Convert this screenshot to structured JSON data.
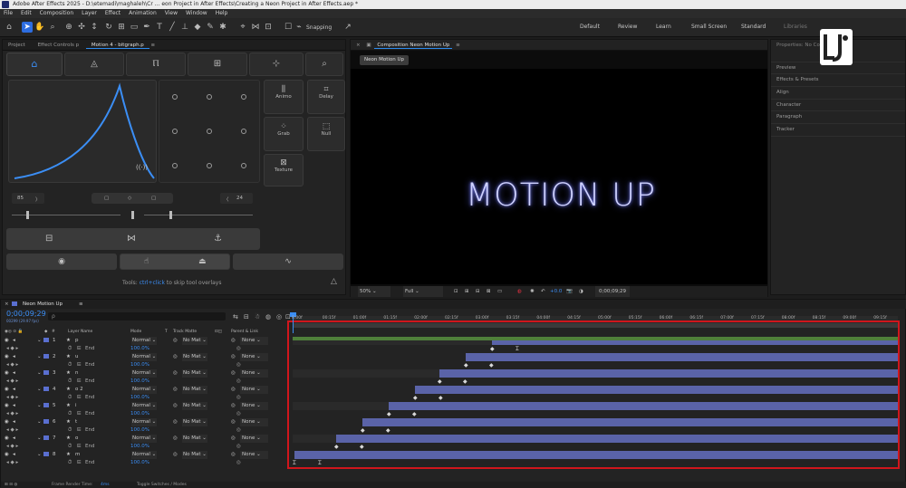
{
  "title": "Adobe After Effects 2025 - D:\\etemadi\\maghaleh\\Cr ... eon Project in After Effects\\Creating a Neon Project in After Effects.aep *",
  "menu": [
    "File",
    "Edit",
    "Composition",
    "Layer",
    "Effect",
    "Animation",
    "View",
    "Window",
    "Help"
  ],
  "toolbar": {
    "snapping": "Snapping"
  },
  "workspaces": [
    "Default",
    "Review",
    "Learn",
    "Small Screen",
    "Standard",
    "Libraries"
  ],
  "left_tabs": [
    "Project",
    "Effect Controls p",
    "Motion 4 - bitgraph.p"
  ],
  "motion": {
    "buttons": [
      "Animo",
      "Delay",
      "Grab",
      "Null",
      "Texture"
    ],
    "left_value": "85",
    "right_value": "24",
    "tools_hint_pre": "Tools:",
    "tools_hint_key": "ctrl+click",
    "tools_hint_post": "to skip tool overlays"
  },
  "comp": {
    "panel_title": "Composition Neon Motion Up",
    "tab": "Neon Motion Up",
    "text": "MOTION UP",
    "zoom": "50%",
    "resolution": "Full",
    "exposure": "+0.0",
    "timecode": "0;00;09;29"
  },
  "right_panel": {
    "items": [
      "Properties: No Co",
      "Preview",
      "Effects & Presets",
      "Align",
      "Character",
      "Paragraph",
      "Tracker"
    ],
    "logo_letters": "LJ"
  },
  "timeline": {
    "tab": "Neon Motion Up",
    "timecode": "0;00;09;29",
    "fps": "00299 (29.97 fps)",
    "search_placeholder": "ρ",
    "headers": {
      "layer_name": "Layer Name",
      "mode": "Mode",
      "t": "T",
      "track_matte": "Track Matte",
      "parent": "Parent & Link"
    },
    "ticks": [
      "0;00f",
      "00:15f",
      "01:00f",
      "01:15f",
      "02:00f",
      "02:15f",
      "03:00f",
      "03:15f",
      "04:00f",
      "04:15f",
      "05:00f",
      "05:15f",
      "06:00f",
      "06:15f",
      "07:00f",
      "07:15f",
      "08:00f",
      "08:15f",
      "09:00f",
      "09:15f"
    ],
    "layers": [
      {
        "num": "1",
        "name": "p",
        "mode": "Normal",
        "matte": "No Mat",
        "parent": "None",
        "sub": "End",
        "val": "100.0%"
      },
      {
        "num": "2",
        "name": "u",
        "mode": "Normal",
        "matte": "No Mat",
        "parent": "None",
        "sub": "End",
        "val": "100.0%"
      },
      {
        "num": "3",
        "name": "n",
        "mode": "Normal",
        "matte": "No Mat",
        "parent": "None",
        "sub": "End",
        "val": "100.0%"
      },
      {
        "num": "4",
        "name": "o 2",
        "mode": "Normal",
        "matte": "No Mat",
        "parent": "None",
        "sub": "End",
        "val": "100.0%"
      },
      {
        "num": "5",
        "name": "i",
        "mode": "Normal",
        "matte": "No Mat",
        "parent": "None",
        "sub": "End",
        "val": "100.0%"
      },
      {
        "num": "6",
        "name": "t",
        "mode": "Normal",
        "matte": "No Mat",
        "parent": "None",
        "sub": "End",
        "val": "100.0%"
      },
      {
        "num": "7",
        "name": "o",
        "mode": "Normal",
        "matte": "No Mat",
        "parent": "None",
        "sub": "End",
        "val": "100.0%"
      },
      {
        "num": "8",
        "name": "m",
        "mode": "Normal",
        "matte": "No Mat",
        "parent": "None",
        "sub": "End",
        "val": "100.0%"
      }
    ],
    "footer_left": "Frame Render Time:",
    "footer_time": "4ms",
    "footer_toggle": "Toggle Switches / Modes"
  }
}
